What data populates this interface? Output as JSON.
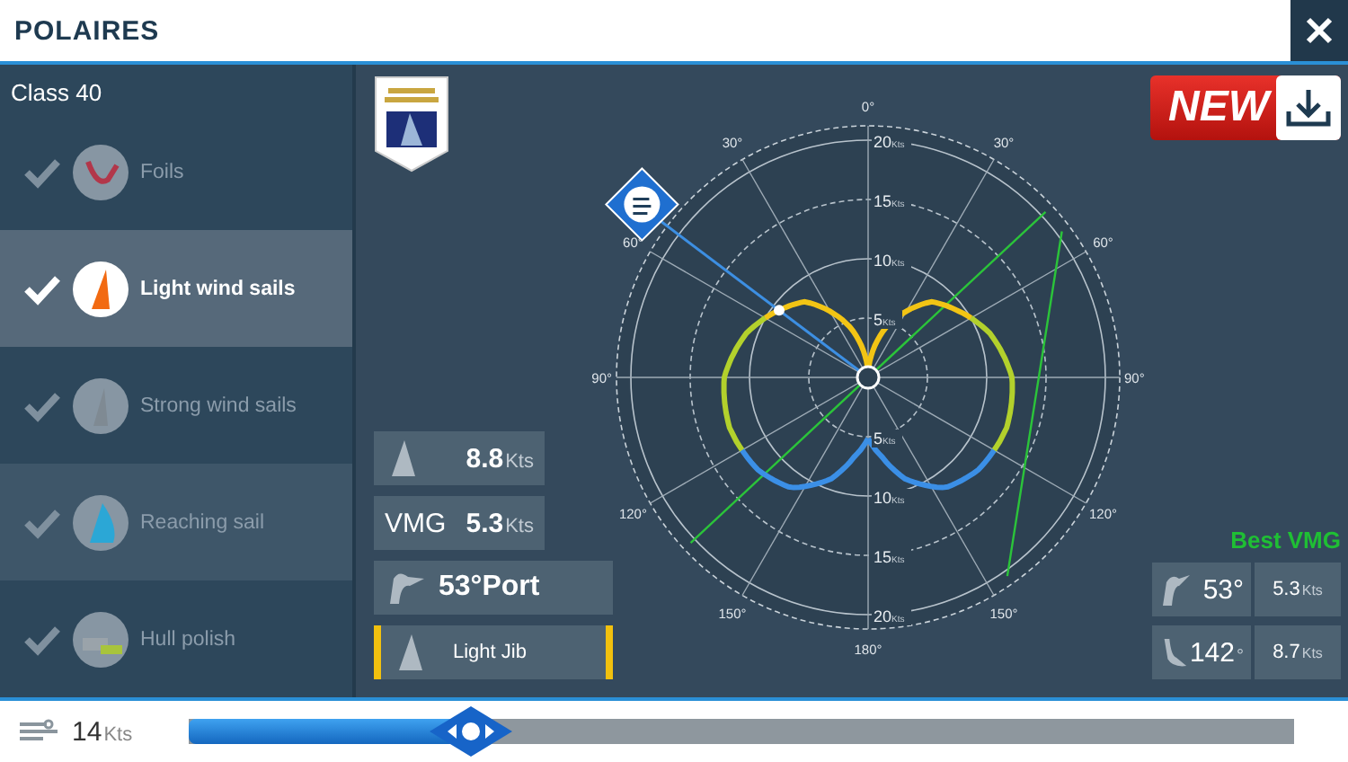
{
  "header": {
    "title": "POLAIRES"
  },
  "sidebar": {
    "title": "Class 40",
    "items": [
      {
        "kind": "foils",
        "label": "Foils",
        "checked": true,
        "selected": false
      },
      {
        "kind": "light-sail",
        "label": "Light wind sails",
        "checked": true,
        "selected": true
      },
      {
        "kind": "strong-sail",
        "label": "Strong wind sails",
        "checked": true,
        "selected": false
      },
      {
        "kind": "reaching-sail",
        "label": "Reaching sail",
        "checked": true,
        "selected": false
      },
      {
        "kind": "hull",
        "label": "Hull polish",
        "checked": true,
        "selected": false
      }
    ]
  },
  "new_button": {
    "label": "NEW"
  },
  "chart": {
    "angle_labels": [
      "0°",
      "30°",
      "60°",
      "90°",
      "120°",
      "150°",
      "180°",
      "150°",
      "120°",
      "90°",
      "60°",
      "30°"
    ],
    "upper_rings": [
      {
        "value": "20",
        "unit": "Kts"
      },
      {
        "value": "15",
        "unit": "Kts"
      },
      {
        "value": "10",
        "unit": "Kts"
      },
      {
        "value": "5",
        "unit": "Kts"
      }
    ],
    "lower_rings": [
      {
        "value": "5",
        "unit": "Kts"
      },
      {
        "value": "10",
        "unit": "Kts"
      },
      {
        "value": "15",
        "unit": "Kts"
      },
      {
        "value": "20",
        "unit": "Kts"
      }
    ]
  },
  "stats": [
    {
      "kind": "boat-speed",
      "value": "8.8",
      "unit": "Kts"
    },
    {
      "kind": "vmg",
      "label": "VMG",
      "value": "5.3",
      "unit": "Kts"
    },
    {
      "kind": "wind-angle",
      "value": "53°Port"
    },
    {
      "kind": "sail",
      "value": "Light Jib"
    }
  ],
  "best_vmg": {
    "title": "Best VMG",
    "rows": [
      {
        "kind": "upwind",
        "angle": "53°",
        "speed": "5.3",
        "unit": "Kts"
      },
      {
        "kind": "downwind",
        "angle": "142",
        "angle_suffix": "°",
        "speed": "8.7",
        "unit": "Kts"
      }
    ]
  },
  "wind": {
    "speed": "14",
    "unit": "Kts",
    "level": 0.255
  }
}
